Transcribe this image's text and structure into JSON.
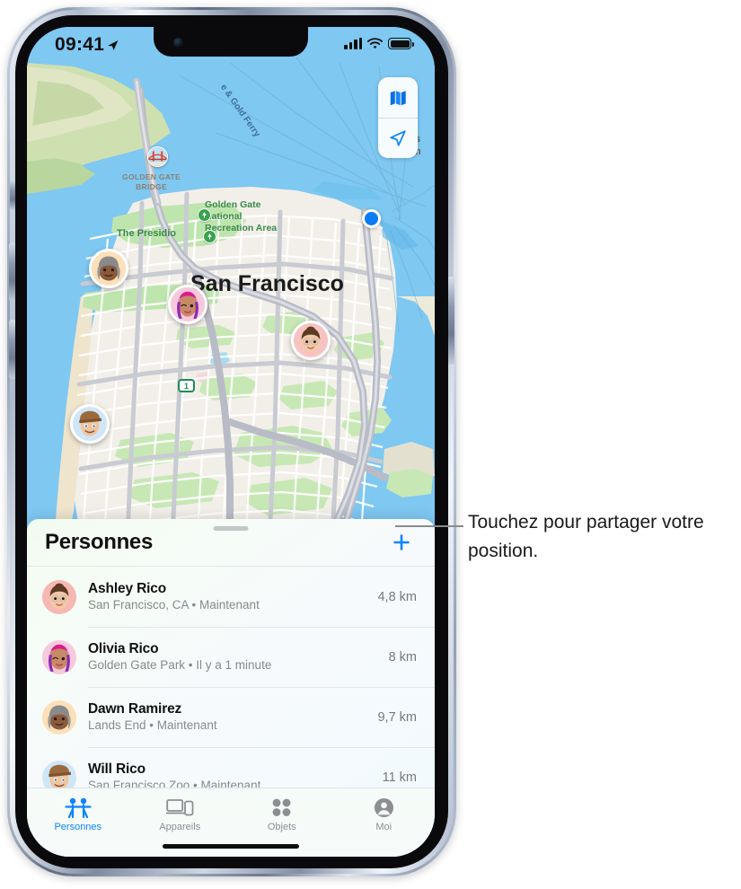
{
  "status_bar": {
    "time": "09:41",
    "location_arrow": "location-arrow-icon",
    "cellular": "signal-bars-icon",
    "wifi": "wifi-icon",
    "battery": "battery-full-icon"
  },
  "map": {
    "city_label": "San Francisco",
    "labels": {
      "golden_gate_bridge": "GOLDEN GATE\nBRIDGE",
      "ggnra": "Golden Gate\nNational\nRecreation Area",
      "presidio": "The Presidio",
      "ferry": "e & Gold Ferry",
      "clipped_right": "s\nn"
    },
    "highway_shield": "1",
    "controls": [
      {
        "name": "map-type-button",
        "icon": "folded-map-icon"
      },
      {
        "name": "recenter-button",
        "icon": "navigation-arrow-icon"
      }
    ],
    "user_location": "blue-location-dot"
  },
  "sheet": {
    "title": "Personnes",
    "add_button_label": "+",
    "people": [
      {
        "name": "Ashley Rico",
        "subtitle": "San Francisco, CA • Maintenant",
        "distance": "4,8 km"
      },
      {
        "name": "Olivia Rico",
        "subtitle": "Golden Gate Park • Il y a 1 minute",
        "distance": "8 km"
      },
      {
        "name": "Dawn Ramirez",
        "subtitle": "Lands End • Maintenant",
        "distance": "9,7 km"
      },
      {
        "name": "Will Rico",
        "subtitle": "San Francisco Zoo • Maintenant",
        "distance": "11 km"
      }
    ]
  },
  "tabbar": {
    "tabs": [
      {
        "label": "Personnes",
        "icon": "people-icon",
        "active": true
      },
      {
        "label": "Appareils",
        "icon": "devices-icon",
        "active": false
      },
      {
        "label": "Objets",
        "icon": "items-grid-icon",
        "active": false
      },
      {
        "label": "Moi",
        "icon": "person-circle-icon",
        "active": false
      }
    ]
  },
  "callout": {
    "text": "Touchez pour partager votre position."
  },
  "colors": {
    "accent": "#0b84fe",
    "map_water": "#7ec8f2",
    "map_land": "#f2efe9",
    "map_park": "#b8e2a8",
    "secondary_text": "#88898c"
  }
}
